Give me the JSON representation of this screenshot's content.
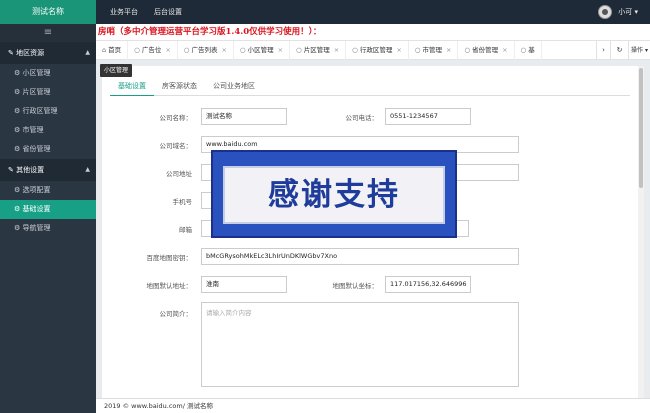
{
  "header": {
    "brand": "测试名称",
    "nav": [
      "业务平台",
      "后台设置"
    ],
    "user": "小可 ▾"
  },
  "sidebar": {
    "toggle": "≡",
    "group1": "地区资源",
    "group1_items": [
      "小区管理",
      "片区管理",
      "行政区管理",
      "市管理",
      "省份管理"
    ],
    "group2": "其他设置",
    "group2_items": [
      "选项配置",
      "基础设置",
      "导航管理"
    ],
    "active_item": "基础设置"
  },
  "notice": "房哨（多中介管理运营平台学习版1.4.0仅供学习使用！）：",
  "tabs": [
    {
      "label": "首页",
      "icon": "home-icon"
    },
    {
      "label": "广告位",
      "icon": "tab-icon"
    },
    {
      "label": "广告列表",
      "icon": "tab-icon"
    },
    {
      "label": "小区管理",
      "icon": "tab-icon"
    },
    {
      "label": "片区管理",
      "icon": "tab-icon"
    },
    {
      "label": "行政区管理",
      "icon": "tab-icon"
    },
    {
      "label": "市管理",
      "icon": "tab-icon"
    },
    {
      "label": "省份管理",
      "icon": "tab-icon"
    },
    {
      "label": "基",
      "icon": "tab-icon"
    }
  ],
  "tab_close": "×",
  "tab_controls": {
    "next": "›",
    "refresh": "↻",
    "ops": "操作 ▾"
  },
  "tooltip": "小区管理",
  "subtabs": [
    "基础设置",
    "房客源状态",
    "公司业务地区"
  ],
  "form": {
    "company_name_label": "公司名称：",
    "company_name": "测试名称",
    "company_phone_label": "公司电话：",
    "company_phone": "0551-1234567",
    "company_domain_label": "公司域名：",
    "company_domain": "www.baidu.com",
    "company_address_label": "公司地址",
    "mobile_label": "手机号",
    "email_label": "邮箱",
    "baidu_key_label": "百度地图密钥：",
    "baidu_key": "bMcGRysohMkELc3LhIrUnDKlWGbv7Xno",
    "map_default_addr_label": "地图默认地址：",
    "map_default_addr": "淮南",
    "map_default_coord_label": "地图默认坐标：",
    "map_default_coord": "117.017156,32.646996",
    "company_intro_label": "公司简介：",
    "company_intro_placeholder": "请输入简介内容"
  },
  "promo": "感谢支持",
  "footer": "2019 © www.baidu.com/ 测试名称"
}
